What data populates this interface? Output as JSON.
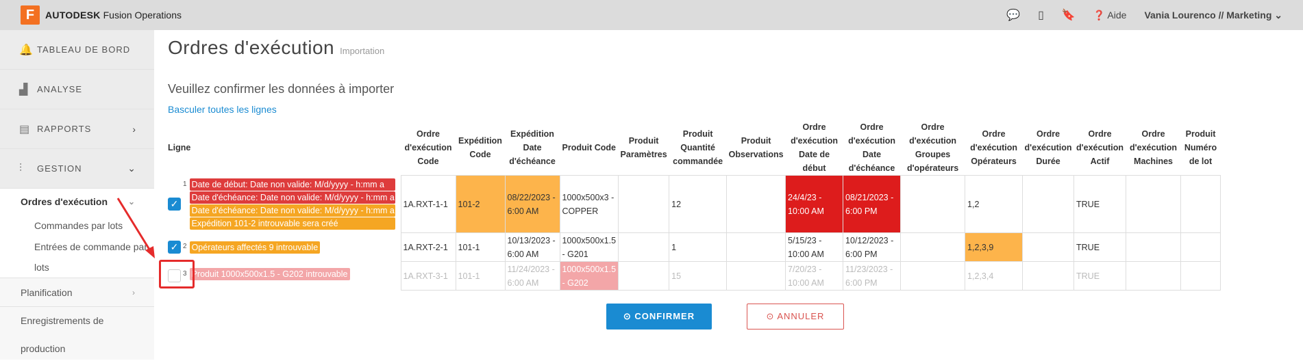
{
  "header": {
    "logo_letter": "F",
    "brand_bold": "AUTODESK",
    "brand_rest": "Fusion Operations",
    "help": "Aide",
    "user": "Vania Lourenco // Marketing"
  },
  "sidebar": {
    "dashboard": "TABLEAU DE BORD",
    "analyse": "ANALYSE",
    "rapports": "RAPPORTS",
    "gestion": "GESTION",
    "ordres": "Ordres d'exécution",
    "commandes": "Commandes par lots",
    "entrees_1": "Entrées de commande par",
    "entrees_2": "lots",
    "planification": "Planification",
    "enregistrements_1": "Enregistrements de",
    "enregistrements_2": "production"
  },
  "page": {
    "title": "Ordres d'exécution",
    "subtitle": "Importation",
    "question": "Veuillez confirmer les données à importer",
    "toggle": "Basculer toutes les lignes"
  },
  "table": {
    "headers": [
      "Ligne",
      "Ordre d'exécution Code",
      "Expédition Code",
      "Expédition Date d'échéance",
      "Produit Code",
      "Produit Paramètres",
      "Produit Quantité commandée",
      "Produit Observations",
      "Ordre d'exécution Date de début",
      "Ordre d'exécution Date d'échéance",
      "Ordre d'exécution Groupes d'opérateurs",
      "Ordre d'exécution Opérateurs",
      "Ordre d'exécution Durée",
      "Ordre d'exécution Actif",
      "Ordre d'exécution Machines",
      "Produit Numéro de lot"
    ],
    "rows": [
      {
        "num": "1",
        "checked": true,
        "msgs": [
          {
            "t": "Date de début: Date non valide: M/d/yyyy - h:mm a",
            "c": "red"
          },
          {
            "t": "Date d'échéance: Date non valide: M/d/yyyy - h:mm a",
            "c": "red"
          },
          {
            "t": "Date d'échéance: Date non valide: M/d/yyyy - h:mm a",
            "c": "orange"
          },
          {
            "t": "Expédition 101-2 introuvable sera créé",
            "c": "orange"
          }
        ],
        "cells": [
          "1A.RXT-1-1",
          "101-2",
          "08/22/2023 - 6:00 AM",
          "1000x500x3 - COPPER",
          "",
          "12",
          "",
          "24/4/23 - 10:00 AM",
          "08/21/2023 - 6:00 PM",
          "",
          "1,2",
          "",
          "TRUE",
          "",
          ""
        ]
      },
      {
        "num": "2",
        "checked": true,
        "msgs": [
          {
            "t": "Opérateurs affectés 9 introuvable",
            "c": "orange"
          }
        ],
        "cells": [
          "1A.RXT-2-1",
          "101-1",
          "10/13/2023 - 6:00 AM",
          "1000x500x1.5 - G201",
          "",
          "1",
          "",
          "5/15/23 - 10:00 AM",
          "10/12/2023 - 6:00 PM",
          "",
          "1,2,3,9",
          "",
          "TRUE",
          "",
          ""
        ]
      },
      {
        "num": "3",
        "checked": false,
        "msgs": [
          {
            "t": "Produit 1000x500x1.5 - G202 introuvable",
            "c": "pink"
          }
        ],
        "cells": [
          "1A.RXT-3-1",
          "101-1",
          "11/24/2023 - 6:00 AM",
          "1000x500x1.5 - G202",
          "",
          "15",
          "",
          "7/20/23 - 10:00 AM",
          "11/23/2023 - 6:00 PM",
          "",
          "1,2,3,4",
          "",
          "TRUE",
          "",
          ""
        ]
      }
    ]
  },
  "buttons": {
    "confirm": "⊙ CONFIRMER",
    "cancel": "⊙ ANNULER"
  },
  "colors": {
    "accent": "#1a8bd2",
    "error": "#dd1c1c",
    "warning": "#fdb44b",
    "annotation": "#e52b2b"
  }
}
